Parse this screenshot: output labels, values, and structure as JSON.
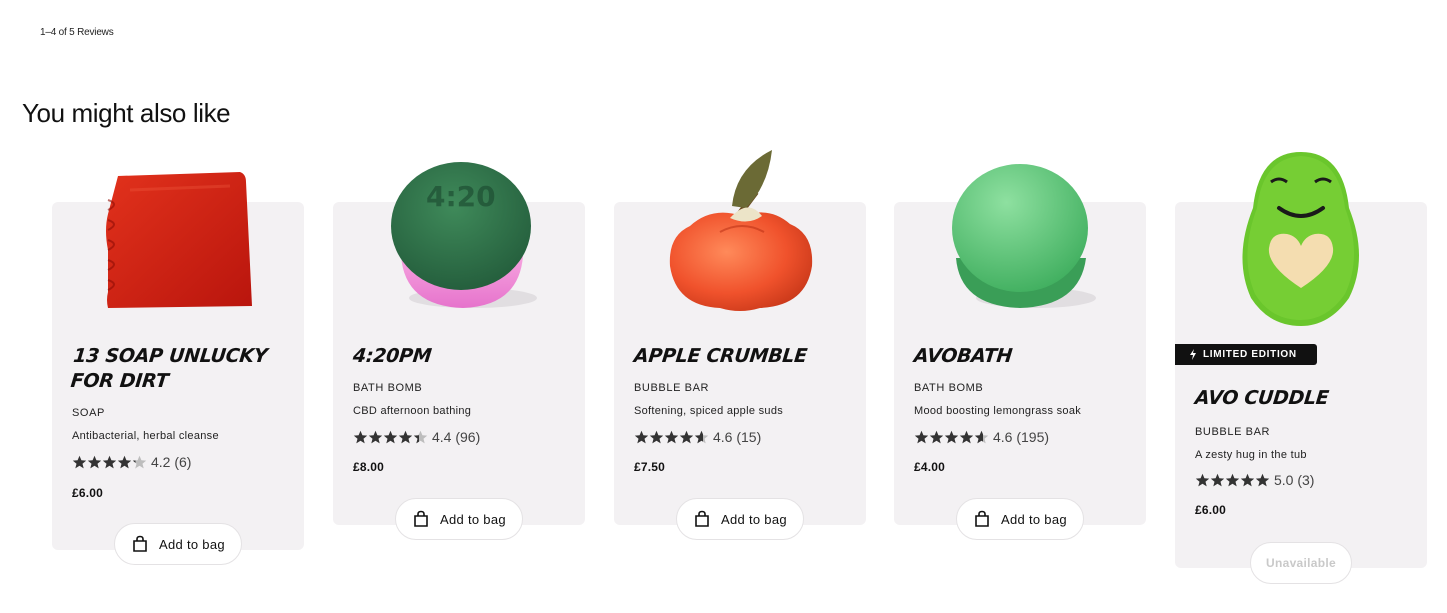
{
  "reviews": {
    "count_text": "1–4 of 5 Reviews"
  },
  "section": {
    "title": "You might also like"
  },
  "colors": {
    "star": "#333333",
    "star_empty": "#bdbdbd",
    "card_bg": "#f3f1f3",
    "badge_bg": "#111111"
  },
  "products": [
    {
      "name": "13 Soap Unlucky For Dirt",
      "category": "SOAP",
      "tagline": "Antibacterial, herbal cleanse",
      "rating": 4.2,
      "rating_text": "4.2 (6)",
      "price": "£6.00",
      "button": "Add to bag",
      "available": true
    },
    {
      "name": "4:20pm",
      "category": "BATH BOMB",
      "tagline": "CBD afternoon bathing",
      "rating": 4.4,
      "rating_text": "4.4 (96)",
      "price": "£8.00",
      "button": "Add to bag",
      "available": true
    },
    {
      "name": "Apple Crumble",
      "category": "BUBBLE BAR",
      "tagline": "Softening, spiced apple suds",
      "rating": 4.6,
      "rating_text": "4.6 (15)",
      "price": "£7.50",
      "button": "Add to bag",
      "available": true
    },
    {
      "name": "Avobath",
      "category": "BATH BOMB",
      "tagline": "Mood boosting lemongrass soak",
      "rating": 4.6,
      "rating_text": "4.6 (195)",
      "price": "£4.00",
      "button": "Add to bag",
      "available": true
    },
    {
      "name": "Avo Cuddle",
      "category": "BUBBLE BAR",
      "tagline": "A zesty hug in the tub",
      "rating": 5.0,
      "rating_text": "5.0 (3)",
      "price": "£6.00",
      "button": "Unavailable",
      "available": false,
      "badge": "LIMITED EDITION"
    }
  ]
}
